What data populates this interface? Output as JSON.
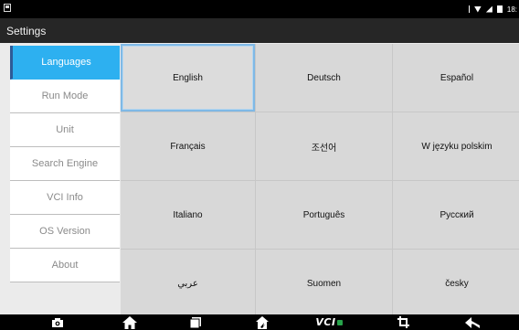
{
  "status_bar": {
    "time": "18:"
  },
  "title_bar": {
    "title": "Settings"
  },
  "sidebar": {
    "items": [
      {
        "label": "Languages",
        "active": true
      },
      {
        "label": "Run Mode",
        "active": false
      },
      {
        "label": "Unit",
        "active": false
      },
      {
        "label": "Search Engine",
        "active": false
      },
      {
        "label": "VCI Info",
        "active": false
      },
      {
        "label": "OS Version",
        "active": false
      },
      {
        "label": "About",
        "active": false
      }
    ]
  },
  "languages": [
    {
      "label": "English",
      "selected": true
    },
    {
      "label": "Deutsch",
      "selected": false
    },
    {
      "label": "Español",
      "selected": false
    },
    {
      "label": "Français",
      "selected": false
    },
    {
      "label": "조선어",
      "selected": false
    },
    {
      "label": "W języku polskim",
      "selected": false
    },
    {
      "label": "Italiano",
      "selected": false
    },
    {
      "label": "Português",
      "selected": false
    },
    {
      "label": "Русский",
      "selected": false
    },
    {
      "label": "عربي",
      "selected": false
    },
    {
      "label": "Suomen",
      "selected": false
    },
    {
      "label": "česky",
      "selected": false
    }
  ],
  "nav_bar": {
    "vci_label": "VCI",
    "icons": [
      "camera-icon",
      "home-icon",
      "window-icon",
      "diagnose-icon",
      "vci-icon",
      "screenshot-crop-icon",
      "back-icon"
    ]
  },
  "colors": {
    "accent": "#2db0f0",
    "active_marker": "#2e5a97",
    "title_bar": "#262626",
    "cell_bg": "#d8d8d8",
    "selected_border": "#7fb9e6"
  }
}
